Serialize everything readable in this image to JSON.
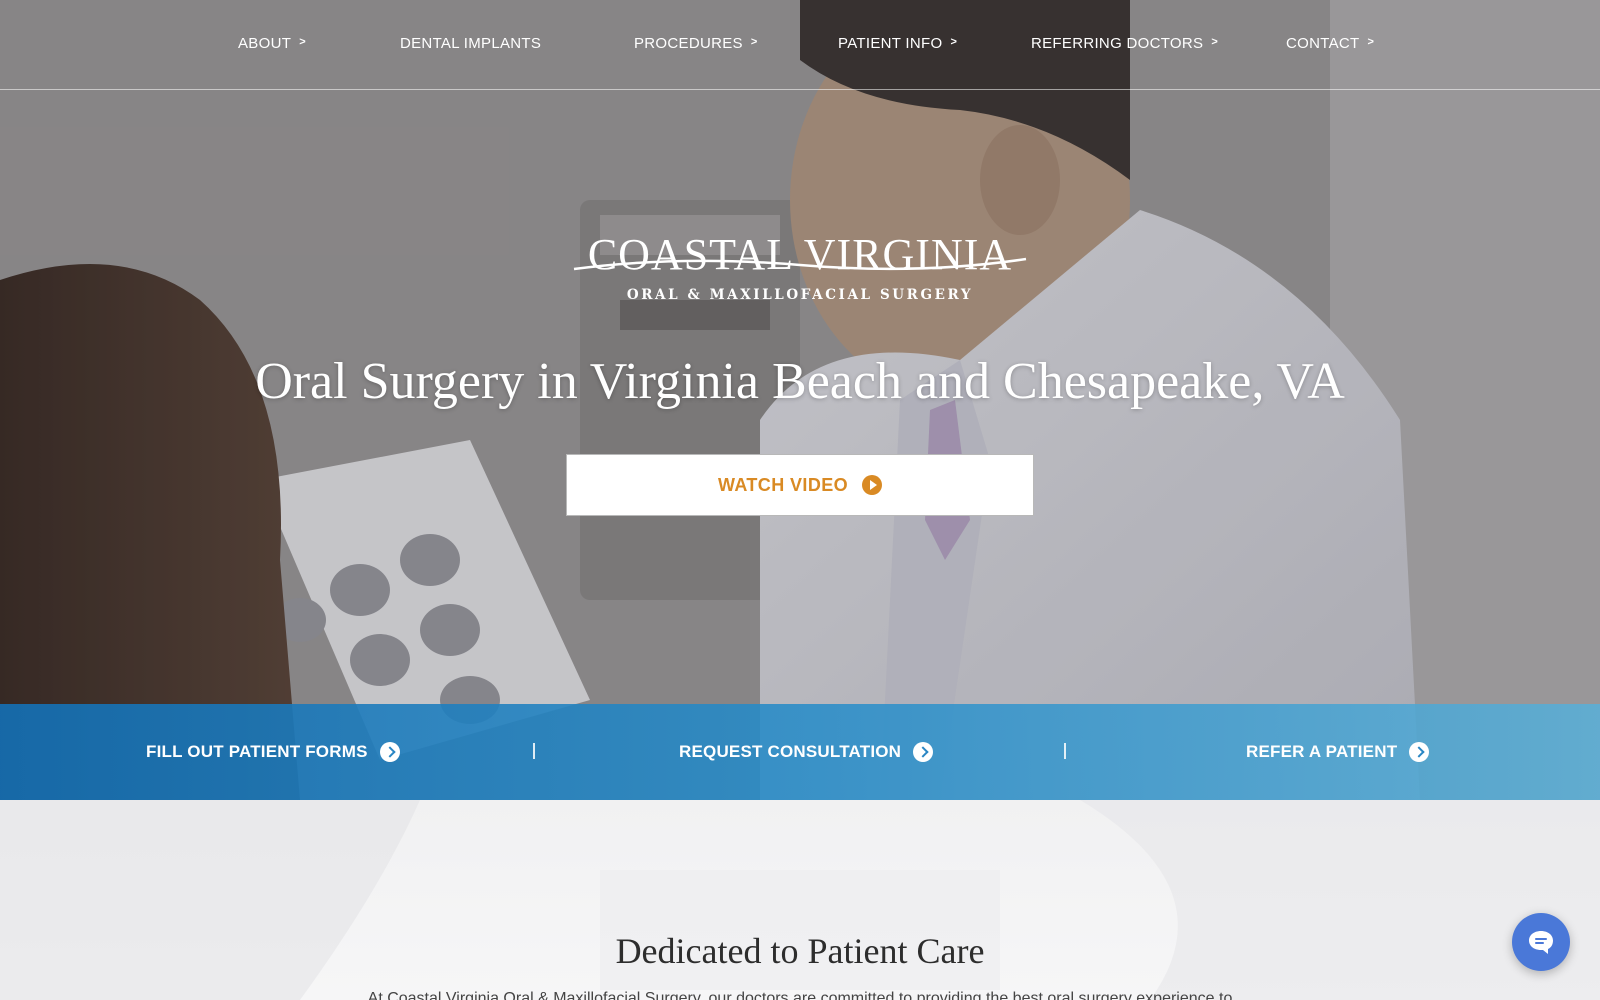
{
  "nav": {
    "items": [
      {
        "label": "ABOUT",
        "has_submenu": true
      },
      {
        "label": "DENTAL IMPLANTS",
        "has_submenu": false
      },
      {
        "label": "PROCEDURES",
        "has_submenu": true
      },
      {
        "label": "PATIENT INFO",
        "has_submenu": true
      },
      {
        "label": "REFERRING DOCTORS",
        "has_submenu": true
      },
      {
        "label": "CONTACT",
        "has_submenu": true
      }
    ]
  },
  "logo": {
    "name": "COASTAL VIRGINIA",
    "subtitle": "ORAL & MAXILLOFACIAL SURGERY"
  },
  "hero": {
    "headline": "Oral Surgery in Virginia Beach and Chesapeake, VA",
    "watch_video_label": "WATCH VIDEO"
  },
  "action_bar": {
    "items": [
      {
        "label": "FILL OUT PATIENT FORMS"
      },
      {
        "label": "REQUEST CONSULTATION"
      },
      {
        "label": "REFER A PATIENT"
      }
    ]
  },
  "section": {
    "title": "Dedicated to Patient Care",
    "text_partial": "At Coastal Virginia Oral & Maxillofacial Surgery, our doctors are committed to providing the best oral surgery experience to"
  },
  "colors": {
    "accent_orange": "#d98a24",
    "action_bar_blue": "#2a86c4",
    "chat_blue": "#4a78d8"
  },
  "icons": {
    "nav_chevron": "chevron-right-icon",
    "watch_video": "play-circle-icon",
    "action_arrow": "arrow-circle-right-icon",
    "chat": "chat-bubble-icon"
  }
}
